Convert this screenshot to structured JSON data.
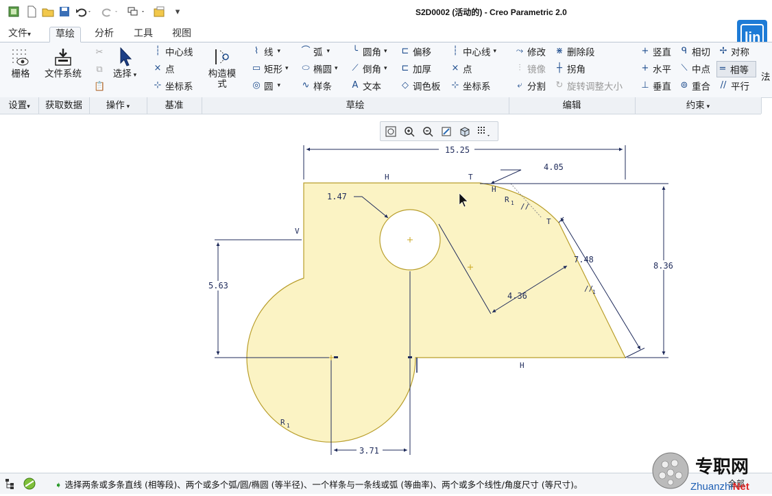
{
  "window": {
    "title": "S2D0002 (活动的) - Creo Parametric 2.0"
  },
  "quick_access": {
    "more": "▾"
  },
  "tabs": [
    {
      "label": "文件",
      "arrow": "▾"
    },
    {
      "label": "草绘",
      "active": true
    },
    {
      "label": "分析"
    },
    {
      "label": "工具"
    },
    {
      "label": "视图"
    }
  ],
  "ribbon": {
    "grid": "栅格",
    "file_system": "文件系统",
    "select": "选择",
    "base": {
      "centerline": "中心线",
      "point": "点",
      "csys": "坐标系"
    },
    "construction_mode": "构造模式",
    "sketch": {
      "line": "线",
      "rect": "矩形",
      "circle": "圆",
      "arc": "弧",
      "ellipse": "椭圆",
      "spline": "样条",
      "fillet": "圆角",
      "chamfer": "倒角",
      "text": "文本",
      "offset": "偏移",
      "thicken": "加厚",
      "palette": "调色板",
      "centerline": "中心线",
      "point": "点",
      "csys": "坐标系"
    },
    "edit": {
      "modify": "修改",
      "mirror": "镜像",
      "divide": "分割",
      "delete_segment": "删除段",
      "corner": "拐角",
      "rotate_resize": "旋转调整大小"
    },
    "constrain": {
      "vertical": "竖直",
      "horizontal": "水平",
      "perpendicular": "垂直",
      "tangent": "相切",
      "midpoint": "中点",
      "coincident": "重合",
      "symmetric": "对称",
      "equal": "相等",
      "parallel": "平行"
    },
    "overflow": "法"
  },
  "groups": {
    "settings": "设置",
    "get_data": "获取数据",
    "operations": "操作",
    "datum": "基准",
    "sketching": "草绘",
    "editing": "编辑",
    "constrain": "约束",
    "arrow": "▾"
  },
  "sketch": {
    "dims": {
      "width": "15.25",
      "chamfer": "4.05",
      "hole": "1.47",
      "height": "8.36",
      "left_h": "5.63",
      "slant": "7.48",
      "offset": "4.36",
      "bottom": "3.71"
    },
    "marks": {
      "h": "H",
      "t": "T",
      "v": "V",
      "r1": "R",
      "r1sub": "1",
      "par": "//",
      "par1": "1",
      "perp": "⊥"
    },
    "fill_color": "#fbf3c4",
    "edge_color": "#b89d2a",
    "dim_color": "#1e2a5a"
  },
  "status": {
    "message": "选择两条或多条直线 (相等段)、两个或多个弧/圆/椭圆 (等半径)、一个样条与一条线或弧 (等曲率)、两个或多个线性/角度尺寸 (等尺寸)。",
    "right_label": "全部"
  },
  "logos": {
    "brand": "lin",
    "watermark_cn": "专职网",
    "watermark_en": "ZhuanzhiNet"
  }
}
